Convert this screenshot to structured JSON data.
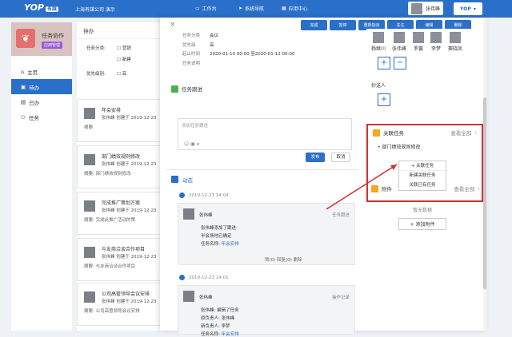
{
  "topbar": {
    "logo": "YOP",
    "logo_sub": "有謀",
    "company": "上海有謀公司 演示",
    "nav": [
      "工作台",
      "系统导航",
      "应用中心"
    ],
    "user_name": "张伟峰",
    "yop": "YOP"
  },
  "sidebar": {
    "app_name": "任务协作",
    "app_tag": "应用管理",
    "items": [
      "主页",
      "待办",
      "已办",
      "任务"
    ]
  },
  "list": {
    "title": "待办",
    "filters": {
      "label1": "任务分类:",
      "opt1": "营销",
      "opt2": "新建",
      "label2": "优先级别:",
      "opt3": "高"
    },
    "cards": [
      {
        "title": "年会安排",
        "meta": "张伟峰  创建于  2019-12-23",
        "summary": "摘要:"
      },
      {
        "title": "部门绩效规则修改",
        "meta": "张伟峰  创建于  2019-12-23",
        "summary": "摘要: 部门绩效规则修改"
      },
      {
        "title": "完成推广策划方案",
        "meta": "张伟峰  创建于  2019-12-23",
        "summary": "摘要: 完成此推广活动的策"
      },
      {
        "title": "与友商洽谈合作项目",
        "meta": "张伟峰  创建于  2019-12-23",
        "summary": "摘要: 与友商洽谈合作项目"
      },
      {
        "title": "公司高管领导会议安排",
        "meta": "张伟峰  创建于  2019-12-23",
        "summary": "摘要: 公司高管领导会议安排"
      }
    ]
  },
  "panel": {
    "buttons": [
      "完成",
      "暂停",
      "重新指派",
      "关注",
      "编辑",
      "删除"
    ],
    "detail": [
      {
        "k": "任务分类",
        "v": "会议"
      },
      {
        "k": "优先级",
        "v": "高"
      },
      {
        "k": "起止时间",
        "v": "2020-01-10 00:00 至2020-01-12 00:00"
      },
      {
        "k": "任务说明",
        "v": ""
      }
    ],
    "follow_title": "任务跟进",
    "follow_placeholder": "添加任务跟进",
    "publish": "发布",
    "cancel": "取消",
    "dynamic_tab": "动态",
    "activities": [
      {
        "time": "2019-12-23 14:04",
        "name": "张伟峰",
        "tag": "任务跟进",
        "line1": "张伟峰添加了跟进:",
        "line2": "半会场地已确定",
        "line3_label": "任务名称:",
        "line3_link": "年会安排",
        "actions": "赞(0)  回复(0)  删除"
      },
      {
        "time": "2019-12-23 14:01",
        "name": "张伟峰",
        "tag": "操作记录",
        "line1": "张伟峰: 编辑了任务",
        "line2": "原负责人: 张伟峰",
        "line3": "新负责人: 李梦",
        "line4_label": "任务名称:",
        "line4_link": "年会安排"
      }
    ]
  },
  "right": {
    "members": [
      "杨继川",
      "张伟峰",
      "罗囊",
      "李梦",
      "窦晓凤"
    ],
    "cc_title": "抄送人",
    "related_title": "关联任务",
    "view_all": "查看全部",
    "related_item": "部门绩效规则修改",
    "dropdown": [
      "关联任务",
      "新建关联任务",
      "关联已有任务"
    ],
    "attach_title": "附件",
    "attach_view_all": "查看全部",
    "no_data": "暂无数据",
    "add_attach": "+ 添加附件"
  }
}
